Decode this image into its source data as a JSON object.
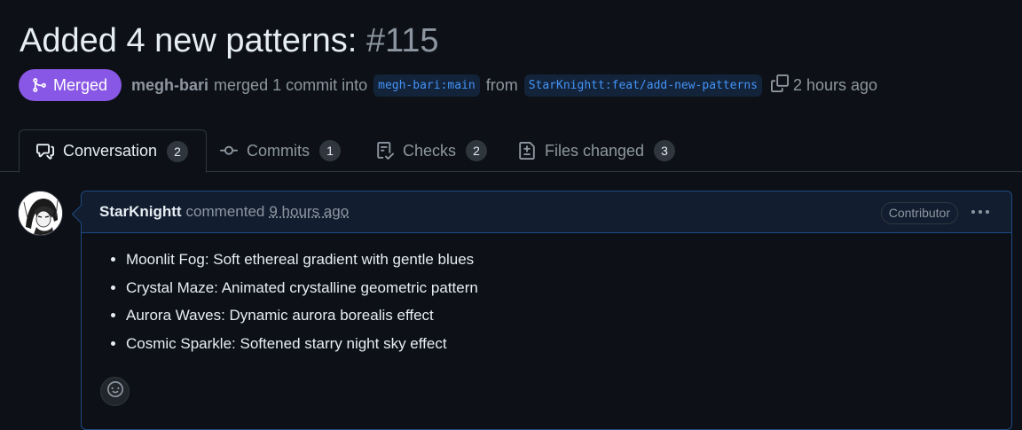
{
  "pr": {
    "title": "Added 4 new patterns:",
    "number": "#115",
    "state": "Merged",
    "author": "megh-bari",
    "action_text": "merged 1 commit into",
    "base_branch": "megh-bari:main",
    "from_text": "from",
    "head_branch": "StarKnightt:feat/add-new-patterns",
    "time_ago": "2 hours ago"
  },
  "tabs": [
    {
      "label": "Conversation",
      "count": "2",
      "icon": "comment-discussion-icon"
    },
    {
      "label": "Commits",
      "count": "1",
      "icon": "git-commit-icon"
    },
    {
      "label": "Checks",
      "count": "2",
      "icon": "checklist-icon"
    },
    {
      "label": "Files changed",
      "count": "3",
      "icon": "file-diff-icon"
    }
  ],
  "comment": {
    "author": "StarKnightt",
    "action": "commented",
    "time": "9 hours ago",
    "role": "Contributor",
    "items": [
      "Moonlit Fog: Soft ethereal gradient with gentle blues",
      "Crystal Maze: Animated crystalline geometric pattern",
      "Aurora Waves: Dynamic aurora borealis effect",
      "Cosmic Sparkle: Softened starry night sky effect"
    ]
  },
  "colors": {
    "background": "#0d1117",
    "merged_badge": "#8957e5",
    "link_blue": "#4493f8",
    "comment_header": "#121d2f",
    "comment_border": "#1f4a84",
    "muted_text": "#8d96a0"
  }
}
